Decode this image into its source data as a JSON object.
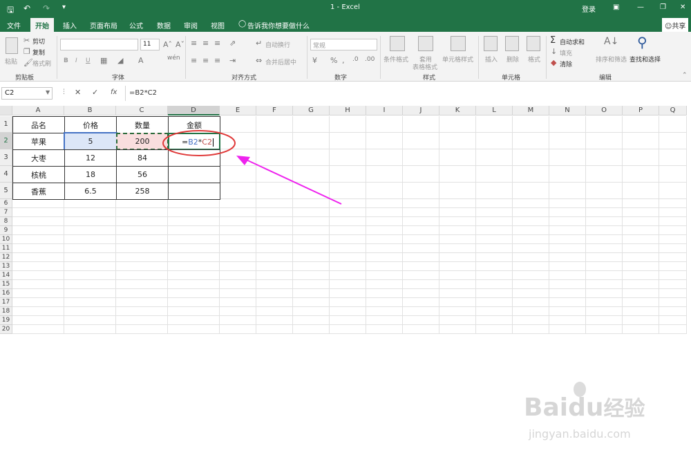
{
  "titlebar": {
    "title": "1  -  Excel",
    "login": "登录"
  },
  "tabs": [
    "文件",
    "开始",
    "插入",
    "页面布局",
    "公式",
    "数据",
    "审阅",
    "视图"
  ],
  "active_tab": "开始",
  "tell_me": "告诉我你想要做什么",
  "share": "共享",
  "ribbon": {
    "clipboard": {
      "paste": "粘贴",
      "cut": "剪切",
      "copy": "复制",
      "format_painter": "格式刷",
      "label": "剪贴板"
    },
    "font": {
      "size": "11",
      "label": "字体",
      "bold": "B",
      "italic": "I",
      "underline": "U"
    },
    "align": {
      "wrap": "自动换行",
      "merge": "合并后居中",
      "label": "对齐方式"
    },
    "number": {
      "format": "常规",
      "label": "数字"
    },
    "styles": {
      "cond": "条件格式",
      "table1": "套用",
      "table2": "表格格式",
      "cell": "单元格样式",
      "label": "样式"
    },
    "cells": {
      "insert": "插入",
      "delete": "删除",
      "format": "格式",
      "label": "单元格"
    },
    "edit": {
      "autosum": "自动求和",
      "fill": "填充",
      "clear": "清除",
      "sort": "排序和筛选",
      "find": "查找和选择",
      "label": "编辑"
    }
  },
  "formula_bar": {
    "name_box": "C2",
    "formula": "=B2*C2",
    "fx": "fx"
  },
  "columns": [
    "A",
    "B",
    "C",
    "D",
    "E",
    "F",
    "G",
    "H",
    "I",
    "J",
    "K",
    "L",
    "M",
    "N",
    "O",
    "P",
    "Q"
  ],
  "rows": [
    "1",
    "2",
    "3",
    "4",
    "5",
    "6",
    "7",
    "8",
    "9",
    "10",
    "11",
    "12",
    "13",
    "14",
    "15",
    "16",
    "17",
    "18",
    "19",
    "20"
  ],
  "table": [
    [
      "品名",
      "价格",
      "数量",
      "金额"
    ],
    [
      "苹果",
      "5",
      "200",
      ""
    ],
    [
      "大枣",
      "12",
      "84",
      ""
    ],
    [
      "核桃",
      "18",
      "56",
      ""
    ],
    [
      "香蕉",
      "6.5",
      "258",
      ""
    ]
  ],
  "edit_cell": {
    "eq": "=",
    "ref1": "B2",
    "op": "*",
    "ref2": "C2"
  },
  "colors": {
    "accent": "#217346",
    "ref_b2": "#4472c4",
    "ref_c2": "#c0504d",
    "arrow": "#ee22ee",
    "circle": "#e03a3a"
  },
  "watermark": {
    "brand_b": "Bai",
    "brand_du": "du",
    "brand_cn": "经验",
    "url": "jingyan.baidu.com"
  }
}
